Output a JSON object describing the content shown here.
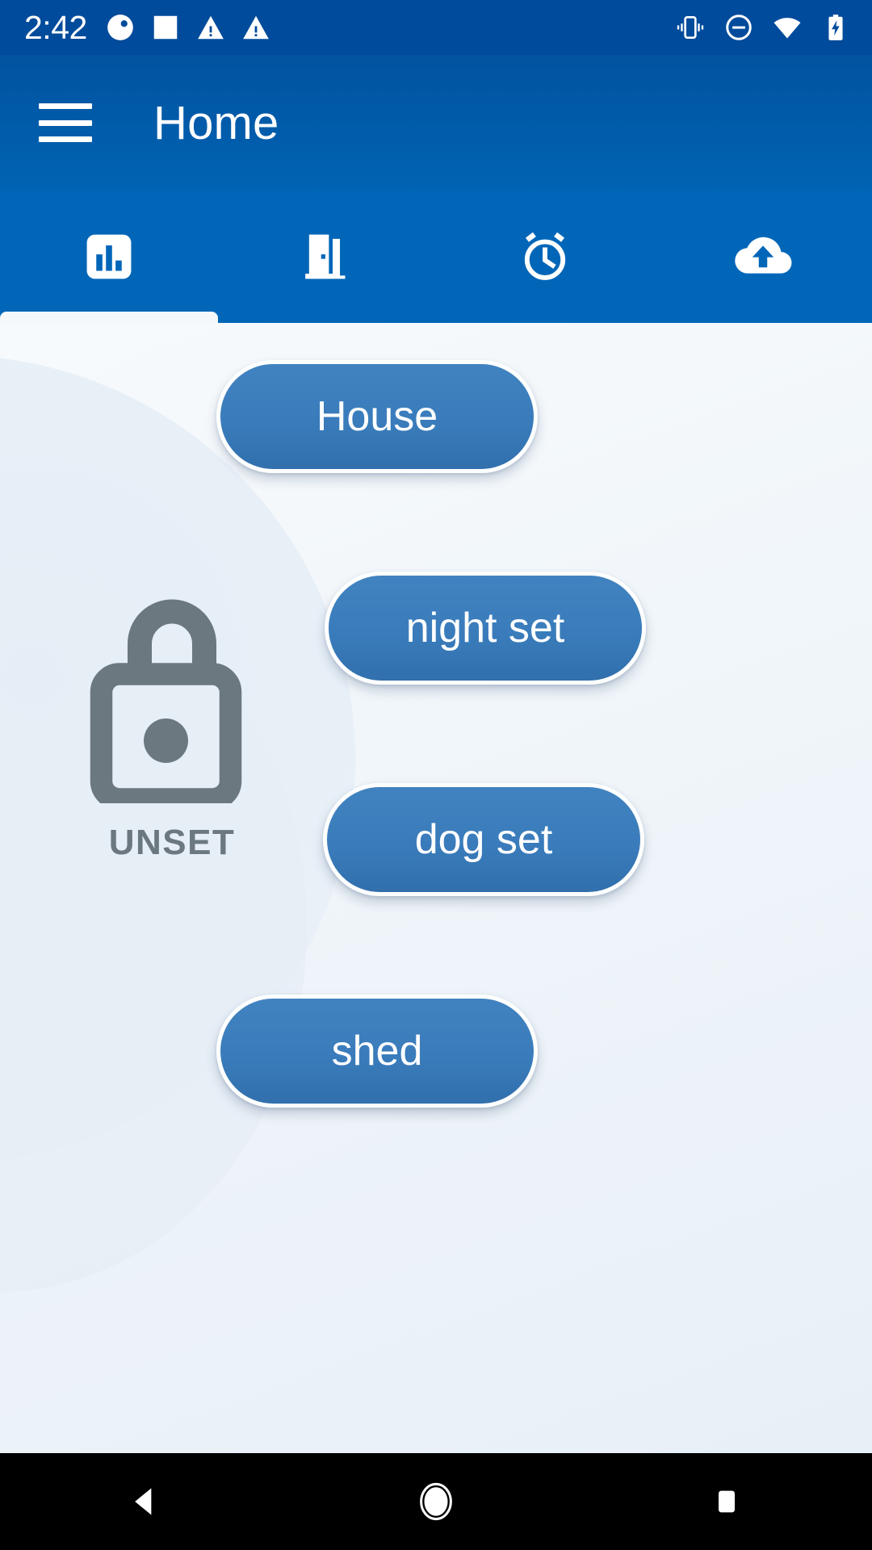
{
  "status_bar": {
    "time": "2:42",
    "left_icons": [
      "contrast-circle-icon",
      "square-notification-icon",
      "warning-triangle-icon",
      "warning-triangle-icon"
    ],
    "right_icons": [
      "vibrate-icon",
      "do-not-disturb-icon",
      "wifi-icon",
      "battery-charging-icon"
    ],
    "background_color": "#004b9b"
  },
  "app_bar": {
    "menu_icon": "hamburger-menu-icon",
    "title": "Home",
    "background_color": "#0163b4"
  },
  "tabs": {
    "active_index": 0,
    "items": [
      {
        "icon": "bar-chart-icon",
        "name": "overview"
      },
      {
        "icon": "door-icon",
        "name": "doors"
      },
      {
        "icon": "alarm-clock-icon",
        "name": "alarms"
      },
      {
        "icon": "cloud-upload-icon",
        "name": "upload"
      }
    ],
    "background_color": "#0166b8",
    "indicator_color": "#f4f8fb"
  },
  "main": {
    "lock": {
      "icon": "unlocked-padlock-icon",
      "status_label": "UNSET",
      "color": "#6b7880"
    },
    "scene_buttons": [
      {
        "label": "House",
        "name": "house"
      },
      {
        "label": "night set",
        "name": "night-set"
      },
      {
        "label": "dog set",
        "name": "dog-set"
      },
      {
        "label": "shed",
        "name": "shed"
      }
    ],
    "button_color": "#3a7cbb",
    "background_color": "#eef4f9"
  },
  "nav_bar": {
    "buttons": [
      {
        "icon": "back-triangle-icon",
        "name": "back"
      },
      {
        "icon": "home-circle-icon",
        "name": "home"
      },
      {
        "icon": "recents-square-icon",
        "name": "recents"
      }
    ],
    "background_color": "#000000"
  }
}
